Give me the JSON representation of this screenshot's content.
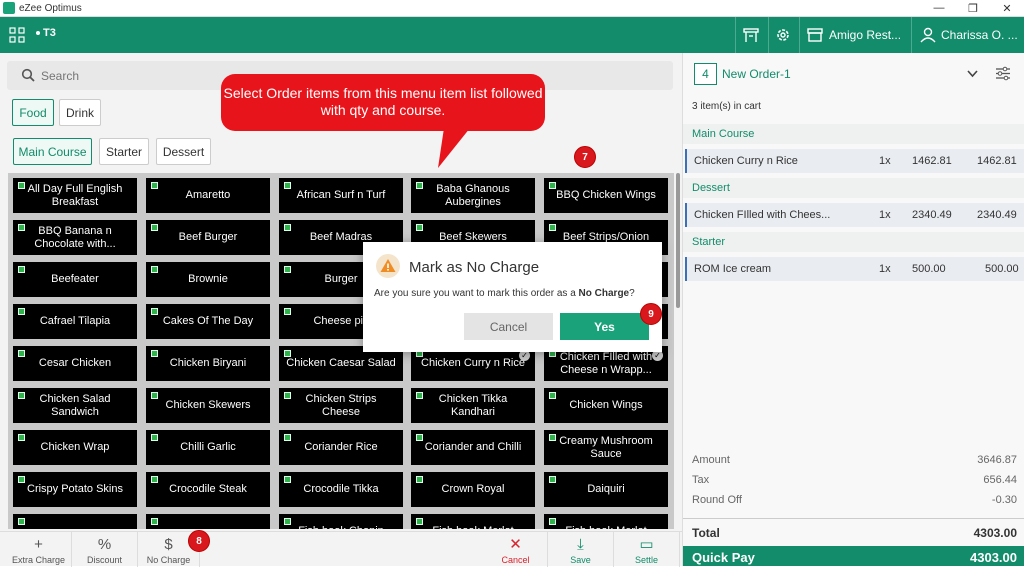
{
  "window": {
    "title": "eZee Optimus",
    "min": "—",
    "max": "❐",
    "close": "✕"
  },
  "topbar": {
    "table": "T3",
    "restaurant": "Amigo Rest...",
    "user": "Charissa O. ..."
  },
  "search": {
    "placeholder": "Search"
  },
  "categories": [
    "Food",
    "Drink"
  ],
  "courses": [
    "Main Course",
    "Starter",
    "Dessert"
  ],
  "menu_items": [
    "All Day Full English Breakfast",
    "Amaretto",
    "African Surf n Turf",
    "Baba Ghanous Aubergines",
    "BBQ Chicken Wings",
    "BBQ Banana n Chocolate with...",
    "Beef Burger",
    "Beef Madras",
    "Beef Skewers",
    "Beef Strips/Onion",
    "Beefeater",
    "Brownie",
    "Burger",
    "",
    "",
    "Cafrael Tilapia",
    "Cakes Of The Day",
    "Cheese piz",
    "",
    "",
    "Cesar Chicken",
    "Chicken Biryani",
    "Chicken Caesar Salad",
    "Chicken Curry n Rice",
    "Chicken FIlled with Cheese n Wrapp...",
    "Chicken Salad Sandwich",
    "Chicken Skewers",
    "Chicken Strips Cheese",
    "Chicken Tikka Kandhari",
    "Chicken Wings",
    "Chicken Wrap",
    "Chilli Garlic",
    "Coriander Rice",
    "Coriander and Chilli",
    "Creamy Mushroom Sauce",
    "Crispy Potato Skins",
    "Crocodile Steak",
    "Crocodile Tikka",
    "Crown Royal",
    "Daiquiri",
    "",
    "",
    "Fish hook Chopin",
    "Fish hook Merlot",
    "Fish hook Merlot"
  ],
  "bottom_actions": [
    {
      "icon": "+",
      "label": "Extra Charge"
    },
    {
      "icon": "%",
      "label": "Discount"
    },
    {
      "icon": "$",
      "label": "No Charge"
    },
    {
      "icon": "✕",
      "label": "Cancel"
    },
    {
      "icon": "⤓",
      "label": "Save"
    },
    {
      "icon": "▭",
      "label": "Settle"
    }
  ],
  "order": {
    "number": "4",
    "name": "New Order-1",
    "cart_count": "3 item(s) in cart",
    "sections": [
      {
        "name": "Main Course",
        "lines": [
          {
            "item": "Chicken Curry n Rice",
            "qty": "1x",
            "rate": "1462.81",
            "amount": "1462.81"
          }
        ]
      },
      {
        "name": "Dessert",
        "lines": [
          {
            "item": "Chicken FIlled with Chees...",
            "qty": "1x",
            "rate": "2340.49",
            "amount": "2340.49"
          }
        ]
      },
      {
        "name": "Starter",
        "lines": [
          {
            "item": "ROM Ice cream",
            "qty": "1x",
            "rate": "500.00",
            "amount": "500.00"
          }
        ]
      }
    ],
    "amount_label": "Amount",
    "amount": "3646.87",
    "tax_label": "Tax",
    "tax": "656.44",
    "roundoff_label": "Round Off",
    "roundoff": "-0.30",
    "total_label": "Total",
    "total": "4303.00",
    "quickpay_label": "Quick Pay",
    "quickpay": "4303.00"
  },
  "callout": {
    "text": "Select Order items from this menu item list followed with qty and course."
  },
  "badges": {
    "b7": "7",
    "b8": "8",
    "b9": "9"
  },
  "dialog": {
    "title": "Mark as No Charge",
    "message_prefix": "Are you sure you want to mark this order as a ",
    "message_bold": "No Charge",
    "message_suffix": "?",
    "cancel": "Cancel",
    "yes": "Yes"
  },
  "colors": {
    "brand": "#128c6a",
    "callout": "#e8141b",
    "item_bg": "#000000",
    "veg_dot": "#2fb34a"
  }
}
